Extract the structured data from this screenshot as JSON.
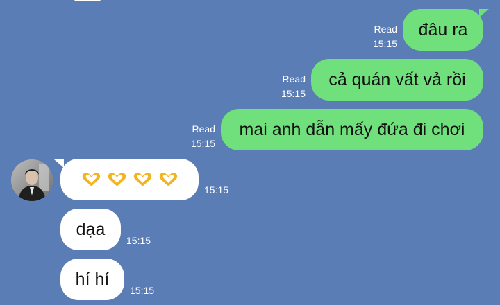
{
  "conversation": {
    "outgoing": [
      {
        "text": "đâu ra",
        "status": "Read",
        "time": "15:15"
      },
      {
        "text": "cả quán vất vả rồi",
        "status": "Read",
        "time": "15:15"
      },
      {
        "text": "mai anh dẫn mấy đứa đi chơi",
        "status": "Read",
        "time": "15:15"
      }
    ],
    "incoming": [
      {
        "emoji": [
          "heart-hands",
          "heart-hands",
          "heart-hands",
          "heart-hands"
        ],
        "time": "15:15"
      },
      {
        "text": "dạa",
        "time": "15:15"
      },
      {
        "text": "hí hí",
        "time": "15:15"
      }
    ]
  },
  "colors": {
    "background": "#5b7db5",
    "outgoing_bubble": "#6fe07c",
    "incoming_bubble": "#ffffff",
    "meta_text": "#ffffff"
  }
}
